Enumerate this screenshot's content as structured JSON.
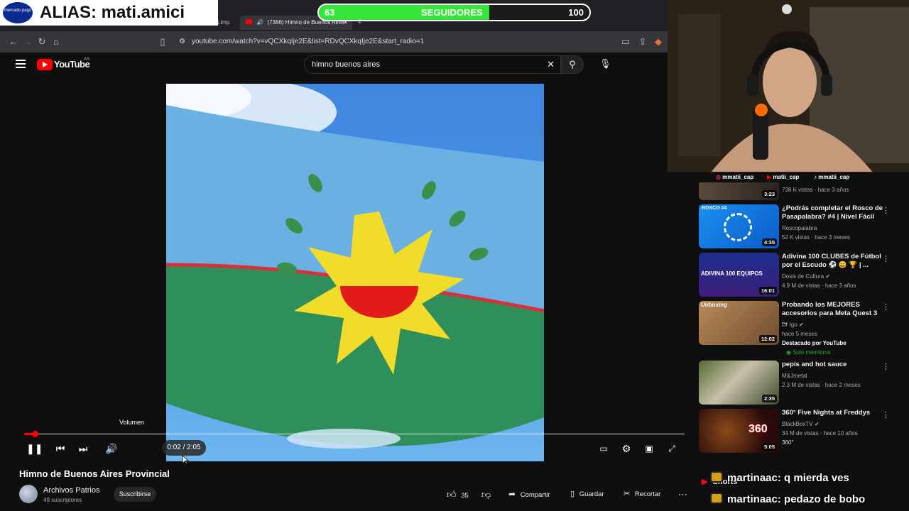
{
  "overlay": {
    "alias": "ALIAS: mati.amici",
    "mercado_pago": "mercado pago",
    "goal": {
      "current": "63",
      "label": "SEGUIDORES",
      "target": "100",
      "progress": 0.63
    },
    "socials": [
      "mmatii_cap",
      "matii_cap",
      "mmatii_cap"
    ]
  },
  "browser": {
    "tabs": [
      {
        "label": "Limp"
      },
      {
        "label": "(7386) Himno de Buenos Aires"
      }
    ],
    "url": "youtube.com/watch?v=vQCXkqIje2E&list=RDvQCXkqIje2E&start_radio=1"
  },
  "youtube": {
    "logo_text": "YouTube",
    "region": "AR",
    "search_value": "himno buenos aires"
  },
  "player": {
    "volume_tooltip": "Volumen",
    "time": "0:02 / 2:05",
    "progress": 0.016
  },
  "video_info": {
    "title": "Himno de Buenos Aires Provincial",
    "channel": "Archivos Patrios",
    "subscribers": "49 suscriptores",
    "subscribe_label": "Suscribirse",
    "likes": "35",
    "share_label": "Compartir",
    "save_label": "Guardar",
    "clip_label": "Recortar"
  },
  "related": [
    {
      "title": "",
      "channel": "",
      "meta": "738 K vistas · hace 3 años",
      "duration": "3:23"
    },
    {
      "title": "¿Podrás completar el Rosco de Pasapalabra? #4 | Nivel Fácil",
      "channel": "Roscopalabra",
      "meta": "52 K vistas · hace 3 meses",
      "duration": "4:35",
      "badge": "ROSCO #4"
    },
    {
      "title": "Adivina 100 CLUBES de Fútbol por el Escudo ⚽ 😄 🏆 | ...",
      "channel": "Dosis de Cultura",
      "meta": "4.9 M de vistas · hace 3 años",
      "duration": "16:01",
      "badge": "ADIVINA 100 EQUIPOS"
    },
    {
      "title": "Probando los MEJORES accesorios para Meta Quest 3 ...",
      "channel": "Dr Igo",
      "meta": "hace 5 meses",
      "extra": "Destacado por YouTube",
      "extra2": "Solo miembros",
      "duration": "12:02",
      "badge": "Unboxing"
    },
    {
      "title": "pepis and hot sauce",
      "channel": "M&Jmetal",
      "meta": "2.3 M de vistas · hace 2 meses",
      "duration": "2:35"
    },
    {
      "title": "360° Five Nights at Freddys",
      "channel": "BlackBoxTV",
      "meta": "34 M de vistas · hace 10 años",
      "extra": "360°",
      "duration": "5:05",
      "badge": "360"
    }
  ],
  "shorts_label": "Shorts",
  "chat": [
    {
      "user": "martinaac",
      "text": ": q mierda ves"
    },
    {
      "user": "martinaac",
      "text": ": pedazo de bobo"
    }
  ]
}
